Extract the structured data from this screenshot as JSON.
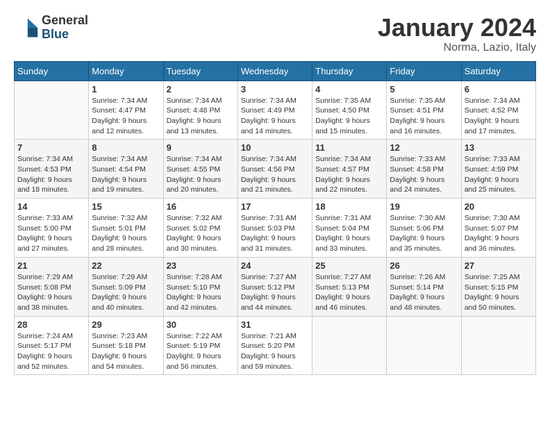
{
  "logo": {
    "line1": "General",
    "line2": "Blue"
  },
  "title": "January 2024",
  "subtitle": "Norma, Lazio, Italy",
  "days_of_week": [
    "Sunday",
    "Monday",
    "Tuesday",
    "Wednesday",
    "Thursday",
    "Friday",
    "Saturday"
  ],
  "weeks": [
    [
      {
        "day": "",
        "info": ""
      },
      {
        "day": "1",
        "info": "Sunrise: 7:34 AM\nSunset: 4:47 PM\nDaylight: 9 hours\nand 12 minutes."
      },
      {
        "day": "2",
        "info": "Sunrise: 7:34 AM\nSunset: 4:48 PM\nDaylight: 9 hours\nand 13 minutes."
      },
      {
        "day": "3",
        "info": "Sunrise: 7:34 AM\nSunset: 4:49 PM\nDaylight: 9 hours\nand 14 minutes."
      },
      {
        "day": "4",
        "info": "Sunrise: 7:35 AM\nSunset: 4:50 PM\nDaylight: 9 hours\nand 15 minutes."
      },
      {
        "day": "5",
        "info": "Sunrise: 7:35 AM\nSunset: 4:51 PM\nDaylight: 9 hours\nand 16 minutes."
      },
      {
        "day": "6",
        "info": "Sunrise: 7:34 AM\nSunset: 4:52 PM\nDaylight: 9 hours\nand 17 minutes."
      }
    ],
    [
      {
        "day": "7",
        "info": "Sunrise: 7:34 AM\nSunset: 4:53 PM\nDaylight: 9 hours\nand 18 minutes."
      },
      {
        "day": "8",
        "info": "Sunrise: 7:34 AM\nSunset: 4:54 PM\nDaylight: 9 hours\nand 19 minutes."
      },
      {
        "day": "9",
        "info": "Sunrise: 7:34 AM\nSunset: 4:55 PM\nDaylight: 9 hours\nand 20 minutes."
      },
      {
        "day": "10",
        "info": "Sunrise: 7:34 AM\nSunset: 4:56 PM\nDaylight: 9 hours\nand 21 minutes."
      },
      {
        "day": "11",
        "info": "Sunrise: 7:34 AM\nSunset: 4:57 PM\nDaylight: 9 hours\nand 22 minutes."
      },
      {
        "day": "12",
        "info": "Sunrise: 7:33 AM\nSunset: 4:58 PM\nDaylight: 9 hours\nand 24 minutes."
      },
      {
        "day": "13",
        "info": "Sunrise: 7:33 AM\nSunset: 4:59 PM\nDaylight: 9 hours\nand 25 minutes."
      }
    ],
    [
      {
        "day": "14",
        "info": "Sunrise: 7:33 AM\nSunset: 5:00 PM\nDaylight: 9 hours\nand 27 minutes."
      },
      {
        "day": "15",
        "info": "Sunrise: 7:32 AM\nSunset: 5:01 PM\nDaylight: 9 hours\nand 28 minutes."
      },
      {
        "day": "16",
        "info": "Sunrise: 7:32 AM\nSunset: 5:02 PM\nDaylight: 9 hours\nand 30 minutes."
      },
      {
        "day": "17",
        "info": "Sunrise: 7:31 AM\nSunset: 5:03 PM\nDaylight: 9 hours\nand 31 minutes."
      },
      {
        "day": "18",
        "info": "Sunrise: 7:31 AM\nSunset: 5:04 PM\nDaylight: 9 hours\nand 33 minutes."
      },
      {
        "day": "19",
        "info": "Sunrise: 7:30 AM\nSunset: 5:06 PM\nDaylight: 9 hours\nand 35 minutes."
      },
      {
        "day": "20",
        "info": "Sunrise: 7:30 AM\nSunset: 5:07 PM\nDaylight: 9 hours\nand 36 minutes."
      }
    ],
    [
      {
        "day": "21",
        "info": "Sunrise: 7:29 AM\nSunset: 5:08 PM\nDaylight: 9 hours\nand 38 minutes."
      },
      {
        "day": "22",
        "info": "Sunrise: 7:29 AM\nSunset: 5:09 PM\nDaylight: 9 hours\nand 40 minutes."
      },
      {
        "day": "23",
        "info": "Sunrise: 7:28 AM\nSunset: 5:10 PM\nDaylight: 9 hours\nand 42 minutes."
      },
      {
        "day": "24",
        "info": "Sunrise: 7:27 AM\nSunset: 5:12 PM\nDaylight: 9 hours\nand 44 minutes."
      },
      {
        "day": "25",
        "info": "Sunrise: 7:27 AM\nSunset: 5:13 PM\nDaylight: 9 hours\nand 46 minutes."
      },
      {
        "day": "26",
        "info": "Sunrise: 7:26 AM\nSunset: 5:14 PM\nDaylight: 9 hours\nand 48 minutes."
      },
      {
        "day": "27",
        "info": "Sunrise: 7:25 AM\nSunset: 5:15 PM\nDaylight: 9 hours\nand 50 minutes."
      }
    ],
    [
      {
        "day": "28",
        "info": "Sunrise: 7:24 AM\nSunset: 5:17 PM\nDaylight: 9 hours\nand 52 minutes."
      },
      {
        "day": "29",
        "info": "Sunrise: 7:23 AM\nSunset: 5:18 PM\nDaylight: 9 hours\nand 54 minutes."
      },
      {
        "day": "30",
        "info": "Sunrise: 7:22 AM\nSunset: 5:19 PM\nDaylight: 9 hours\nand 56 minutes."
      },
      {
        "day": "31",
        "info": "Sunrise: 7:21 AM\nSunset: 5:20 PM\nDaylight: 9 hours\nand 59 minutes."
      },
      {
        "day": "",
        "info": ""
      },
      {
        "day": "",
        "info": ""
      },
      {
        "day": "",
        "info": ""
      }
    ]
  ]
}
